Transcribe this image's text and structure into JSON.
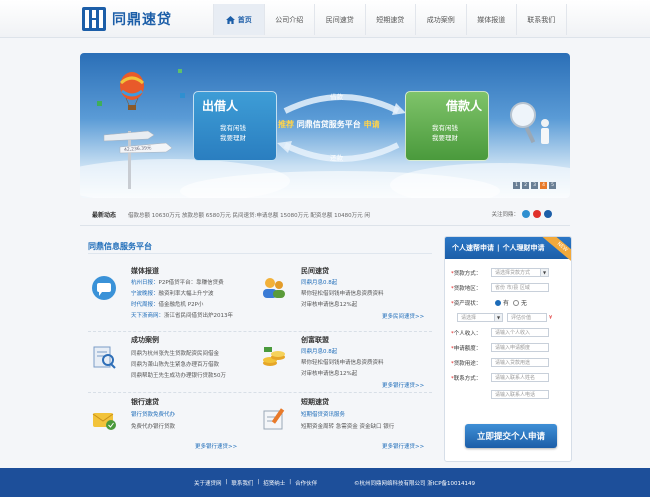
{
  "brand": {
    "name": "同鼎速贷"
  },
  "nav": [
    {
      "label": "首页",
      "active": true
    },
    {
      "label": "公司介绍"
    },
    {
      "label": "民间速贷"
    },
    {
      "label": "短期速贷"
    },
    {
      "label": "成功案例"
    },
    {
      "label": "媒体报道"
    },
    {
      "label": "联系我们"
    }
  ],
  "banner": {
    "left_card": {
      "title": "出借人",
      "lines": [
        "我有闲钱",
        "我要理财"
      ]
    },
    "right_card": {
      "title": "借款人",
      "lines": [
        "我有闲钱",
        "我要理财"
      ]
    },
    "mid_prefix": "推荐",
    "mid_text": "同鼎信贷服务平台",
    "mid_suffix": "申请",
    "top_arc": "借款",
    "bottom_arc": "还款",
    "sign": "42,236.39元",
    "slides": [
      "1",
      "2",
      "3",
      "4",
      "5"
    ]
  },
  "ticker": {
    "label": "最新动态",
    "text": "借款总额 10630万元  放款总额 6580万元    民间速贷:申请总额 15080万元  配资总额 10480万元  闲",
    "follow_label": "关注同鼎："
  },
  "services": {
    "title": "同鼎信息服务平台",
    "items": [
      {
        "title": "媒体报道",
        "lines": [
          {
            "tag": "杭州日报：",
            "text": "P2P借贷平台：靠赚信贷费"
          },
          {
            "tag": "宁波晚报：",
            "text": "融资利率大幅上升宁波"
          },
          {
            "tag": "时代周报：",
            "text": "借金融危机 P2P小"
          },
          {
            "tag": "天下浙商网：",
            "text": "浙江省民间借贷出炉2013年"
          }
        ],
        "more": ""
      },
      {
        "title": "民间速贷",
        "lines": [
          {
            "tag": "同鼎月息0.8起",
            "text": ""
          },
          {
            "tag": "",
            "text": "帮你轻松借到钱申请信息资质资料"
          },
          {
            "tag": "",
            "text": "对审核申请信息12%起"
          }
        ],
        "more": "更多民间速贷>>"
      },
      {
        "title": "成功案例",
        "lines": [
          {
            "tag": "",
            "text": "同鼎为杭州张先生贷款配资民间借金"
          },
          {
            "tag": "",
            "text": "同鼎为萧山陈先生紧急办理百万借款"
          },
          {
            "tag": "",
            "text": "同鼎帮助王先生成功办理银行贷款50万"
          }
        ],
        "more": ""
      },
      {
        "title": "创富联盟",
        "lines": [
          {
            "tag": "同鼎月息0.8起",
            "text": ""
          },
          {
            "tag": "",
            "text": "帮你轻松借到钱申请信息资质资料"
          },
          {
            "tag": "",
            "text": "对审核申请信息12%起"
          }
        ],
        "more": "更多银行速贷>>"
      },
      {
        "title": "银行速贷",
        "lines": [
          {
            "tag": "银行贷款免费代办",
            "text": ""
          },
          {
            "tag": "",
            "text": "免费代办银行贷款"
          }
        ],
        "more": "更多银行速贷>>"
      },
      {
        "title": "短期速贷",
        "lines": [
          {
            "tag": "短期借贷资讯服务",
            "text": ""
          },
          {
            "tag": "",
            "text": "短期资金周转  急需资金  资金缺口  银行"
          }
        ],
        "more": "更多银行速贷>>"
      }
    ]
  },
  "apply": {
    "tab_personal": "个人速帮申请",
    "tab_finance": "个人理财申请",
    "badge": "NEW",
    "fields": [
      {
        "label": "贷款方式：",
        "value": "请选择贷款方式",
        "type": "select"
      },
      {
        "label": "贷款地区：",
        "value": "省份  市/县  区域",
        "type": "text"
      },
      {
        "label": "资产现状：",
        "value": "",
        "type": "radio",
        "options": [
          "有",
          "无"
        ]
      },
      {
        "label": "",
        "value": "请选择",
        "type": "select2",
        "value2": "评估价值"
      },
      {
        "label": "个人收入：",
        "value": "请输入个人收入",
        "type": "text"
      },
      {
        "label": "申请额度：",
        "value": "请输入申请额度",
        "type": "text"
      },
      {
        "label": "贷款用途：",
        "value": "请输入贷款用途",
        "type": "text"
      },
      {
        "label": "联系方式：",
        "value": "请输入联系人姓名",
        "type": "text"
      },
      {
        "label": "",
        "value": "请输入联系人电话",
        "type": "text"
      }
    ],
    "submit": "立即提交个人申请"
  },
  "footer": {
    "links": [
      "关于速贷网",
      "|",
      "联系我们",
      "|",
      "招贤纳士",
      "|",
      "合作伙伴"
    ],
    "copy": "©杭州同鼎网络科技有限公司  浙ICP备10014149"
  },
  "colors": {
    "primary": "#1c5ea8",
    "accent": "#e87a2a",
    "footer": "#1d4f9a"
  }
}
